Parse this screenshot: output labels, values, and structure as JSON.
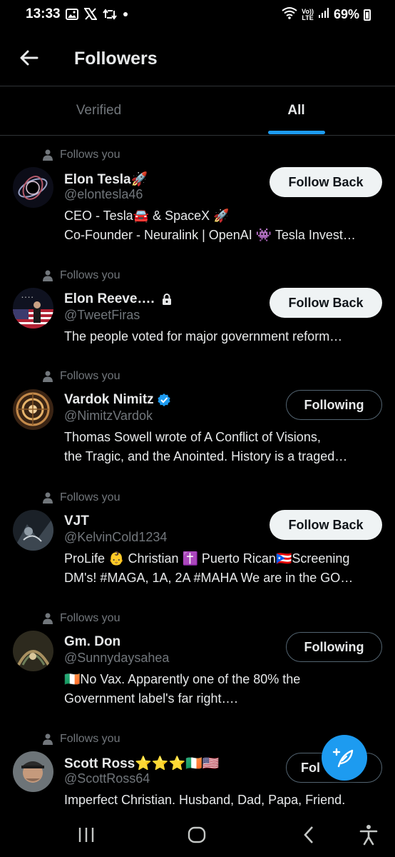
{
  "status_bar": {
    "time": "13:33",
    "battery": "69%",
    "volte_top": "Vo))",
    "volte_bottom": "LTE"
  },
  "header": {
    "title": "Followers",
    "back_icon": "arrow-left-icon"
  },
  "tabs": [
    {
      "label": "Verified",
      "selected": false
    },
    {
      "label": "All",
      "selected": true
    }
  ],
  "colors": {
    "accent": "#1d9bf0",
    "background": "#000000",
    "muted": "#71767b",
    "text": "#e7e9ea"
  },
  "followers": [
    {
      "follows_you": "Follows you",
      "name": "Elon Tesla🚀",
      "handle": "@elontesla46",
      "bio": [
        "CEO - Tesla🚘 & SpaceX 🚀",
        "Co-Founder - Neuralink | OpenAI 👾 Tesla Invest…"
      ],
      "button": "Follow Back",
      "verified": false,
      "protected": false
    },
    {
      "follows_you": "Follows you",
      "name": "Elon Reeve….",
      "handle": "@TweetFiras",
      "bio": [
        "The people voted for major government reform…"
      ],
      "button": "Follow Back",
      "verified": false,
      "protected": true
    },
    {
      "follows_you": "Follows you",
      "name": "Vardok Nimitz",
      "handle": "@NimitzVardok",
      "bio": [
        "Thomas Sowell wrote of A Conflict of Visions,",
        "the Tragic, and the Anointed. History is a traged…"
      ],
      "button": "Following",
      "verified": true,
      "protected": false
    },
    {
      "follows_you": "Follows you",
      "name": "VJT",
      "handle": "@KelvinCold1234",
      "bio": [
        "ProLife 👶 Christian ✝️ Puerto Rican🇵🇷Screening",
        "DM's! #MAGA, 1A, 2A #MAHA We are in the GO…"
      ],
      "button": "Follow Back",
      "verified": false,
      "protected": false
    },
    {
      "follows_you": "Follows you",
      "name": "Gm. Don",
      "handle": "@Sunnydaysahea",
      "bio": [
        "🇮🇪No Vax.  Apparently one of the 80% the",
        "Government label's far right…."
      ],
      "button": "Following",
      "verified": false,
      "protected": false
    },
    {
      "follows_you": "Follows you",
      "name": "Scott Ross⭐⭐⭐🇮🇪🇺🇸",
      "handle": "@ScottRoss64",
      "bio": [
        "Imperfect Christian. Husband, Dad, Papa, Friend."
      ],
      "button": "Fol",
      "verified": false,
      "protected": false
    }
  ],
  "fab": {
    "icon": "compose-feather-icon"
  },
  "nav": {
    "recents": "recents-icon",
    "home": "home-icon",
    "back": "back-chevron-icon",
    "accessibility": "accessibility-icon"
  }
}
